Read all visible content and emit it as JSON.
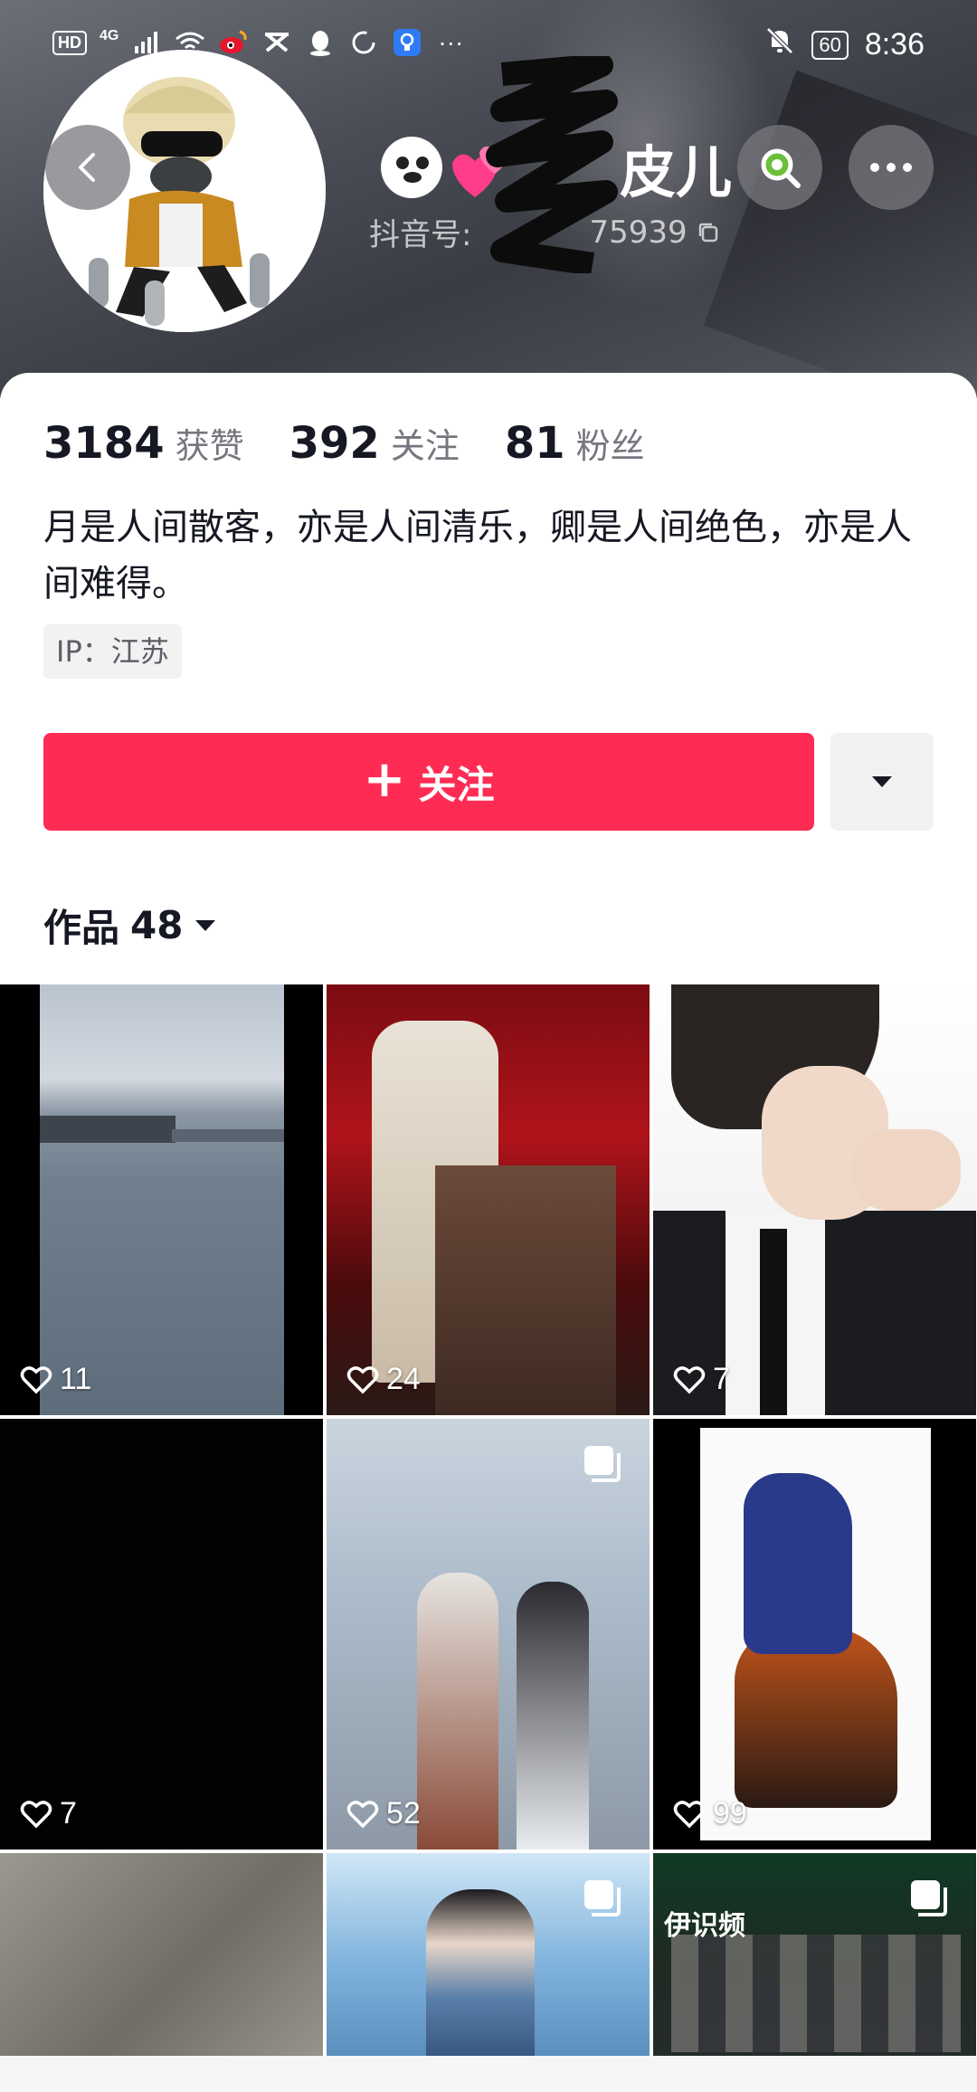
{
  "status_bar": {
    "left_labels": [
      "HD",
      "4G"
    ],
    "signal_text": "",
    "battery": "60",
    "time": "8:36"
  },
  "profile": {
    "nickname_visible_tail": "皮儿",
    "id_label": "抖音号:",
    "id_visible_tail": "75939",
    "stats": [
      {
        "value": "3184",
        "label": "获赞"
      },
      {
        "value": "392",
        "label": "关注"
      },
      {
        "value": "81",
        "label": "粉丝"
      }
    ],
    "bio": "月是人间散客，亦是人间清乐，卿是人间绝色，亦是人间难得。",
    "ip": "IP：江苏"
  },
  "actions": {
    "follow_label": "关注"
  },
  "works_tab": {
    "label": "作品",
    "count": "48"
  },
  "grid": {
    "tiles": [
      {
        "likes": "11",
        "multi": false
      },
      {
        "likes": "24",
        "multi": false
      },
      {
        "likes": "7",
        "multi": false
      },
      {
        "likes": "7",
        "multi": false
      },
      {
        "likes": "52",
        "multi": true
      },
      {
        "likes": "99",
        "multi": false
      },
      {
        "likes": "",
        "multi": false
      },
      {
        "likes": "",
        "multi": true
      },
      {
        "likes": "",
        "multi": true
      }
    ],
    "partial_text_tile9": "伊识频"
  },
  "colors": {
    "accent": "#fe2c55",
    "text_primary": "#161823",
    "text_secondary": "#75777f"
  }
}
